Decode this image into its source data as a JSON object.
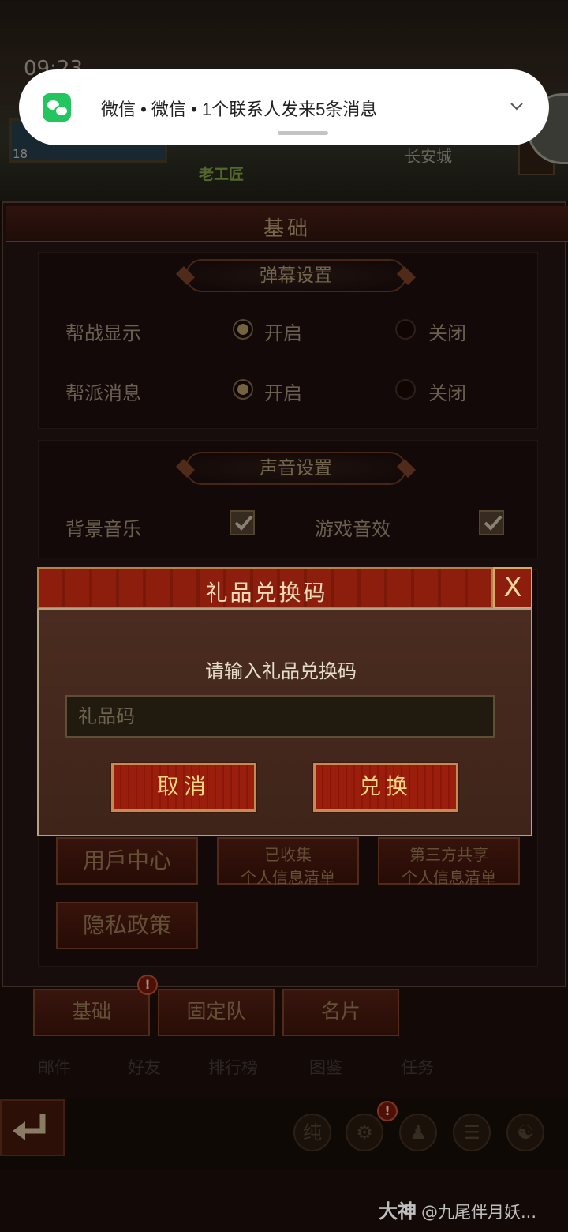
{
  "status_bar": {
    "time": "09:23"
  },
  "world": {
    "level": "18",
    "npc_name": "老工匠",
    "city_name": "长安城"
  },
  "notification": {
    "app": "微信",
    "text": "微信 • 微信 • 1个联系人发来5条消息",
    "icon": "wechat-icon"
  },
  "panel": {
    "title": "基础",
    "danmaku_section": {
      "header": "弹幕设置",
      "rows": [
        {
          "label": "帮战显示",
          "on_label": "开启",
          "off_label": "关闭",
          "selected": "on"
        },
        {
          "label": "帮派消息",
          "on_label": "开启",
          "off_label": "关闭",
          "selected": "on"
        }
      ]
    },
    "sound_section": {
      "header": "声音设置",
      "bgm_label": "背景音乐",
      "bgm_checked": true,
      "sfx_label": "游戏音效",
      "sfx_checked": true
    },
    "info_buttons": {
      "user_center": "用戶中心",
      "collected_line1": "已收集",
      "collected_line2": "个人信息清单",
      "third_party_line1": "第三方共享",
      "third_party_line2": "个人信息清单",
      "privacy": "隐私政策"
    }
  },
  "tabs": [
    {
      "label": "基础",
      "alert": "!"
    },
    {
      "label": "固定队"
    },
    {
      "label": "名片"
    }
  ],
  "nav": [
    "邮件",
    "好友",
    "排行榜",
    "图鉴",
    "任务"
  ],
  "toolbar": {
    "tools": [
      "纯",
      "⚙",
      "♟",
      "☰",
      "☯"
    ],
    "alert": "!"
  },
  "modal": {
    "title": "礼品兑换码",
    "close": "X",
    "prompt": "请输入礼品兑换码",
    "placeholder": "礼品码",
    "cancel": "取消",
    "confirm": "兑换"
  },
  "watermark": {
    "brand": "大神",
    "user": "@九尾伴月妖..."
  }
}
